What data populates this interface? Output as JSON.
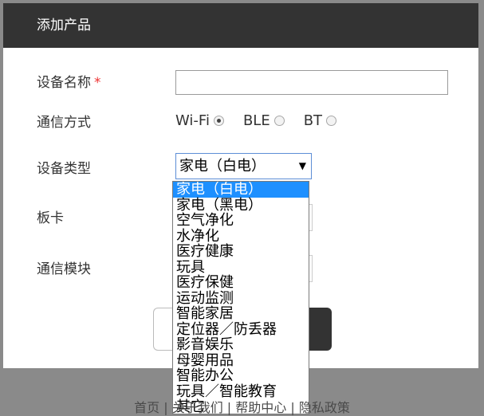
{
  "modal": {
    "title": "添加产品",
    "device_name_label": "设备名称",
    "required_mark": "*",
    "comm_method_label": "通信方式",
    "device_type_label": "设备类型",
    "board_label": "板卡",
    "comm_module_label": "通信模块"
  },
  "comm_options": [
    {
      "label": "Wi-Fi",
      "checked": true
    },
    {
      "label": "BLE",
      "checked": false
    },
    {
      "label": "BT",
      "checked": false
    }
  ],
  "device_type": {
    "selected": "家电（白电）",
    "options": [
      "家电（白电）",
      "家电（黑电）",
      "空气净化",
      "水净化",
      "医疗健康",
      "玩具",
      "医疗保健",
      "运动监测",
      "智能家居",
      "定位器／防丢器",
      "影音娱乐",
      "母婴用品",
      "智能办公",
      "玩具／智能教育",
      "其它"
    ]
  },
  "footer": {
    "text": "首页 | 关于我们 | 帮助中心 | 隐私政策"
  },
  "colors": {
    "header_bg": "#333333",
    "selected_bg": "#1e90ff",
    "required": "#ee3333"
  }
}
